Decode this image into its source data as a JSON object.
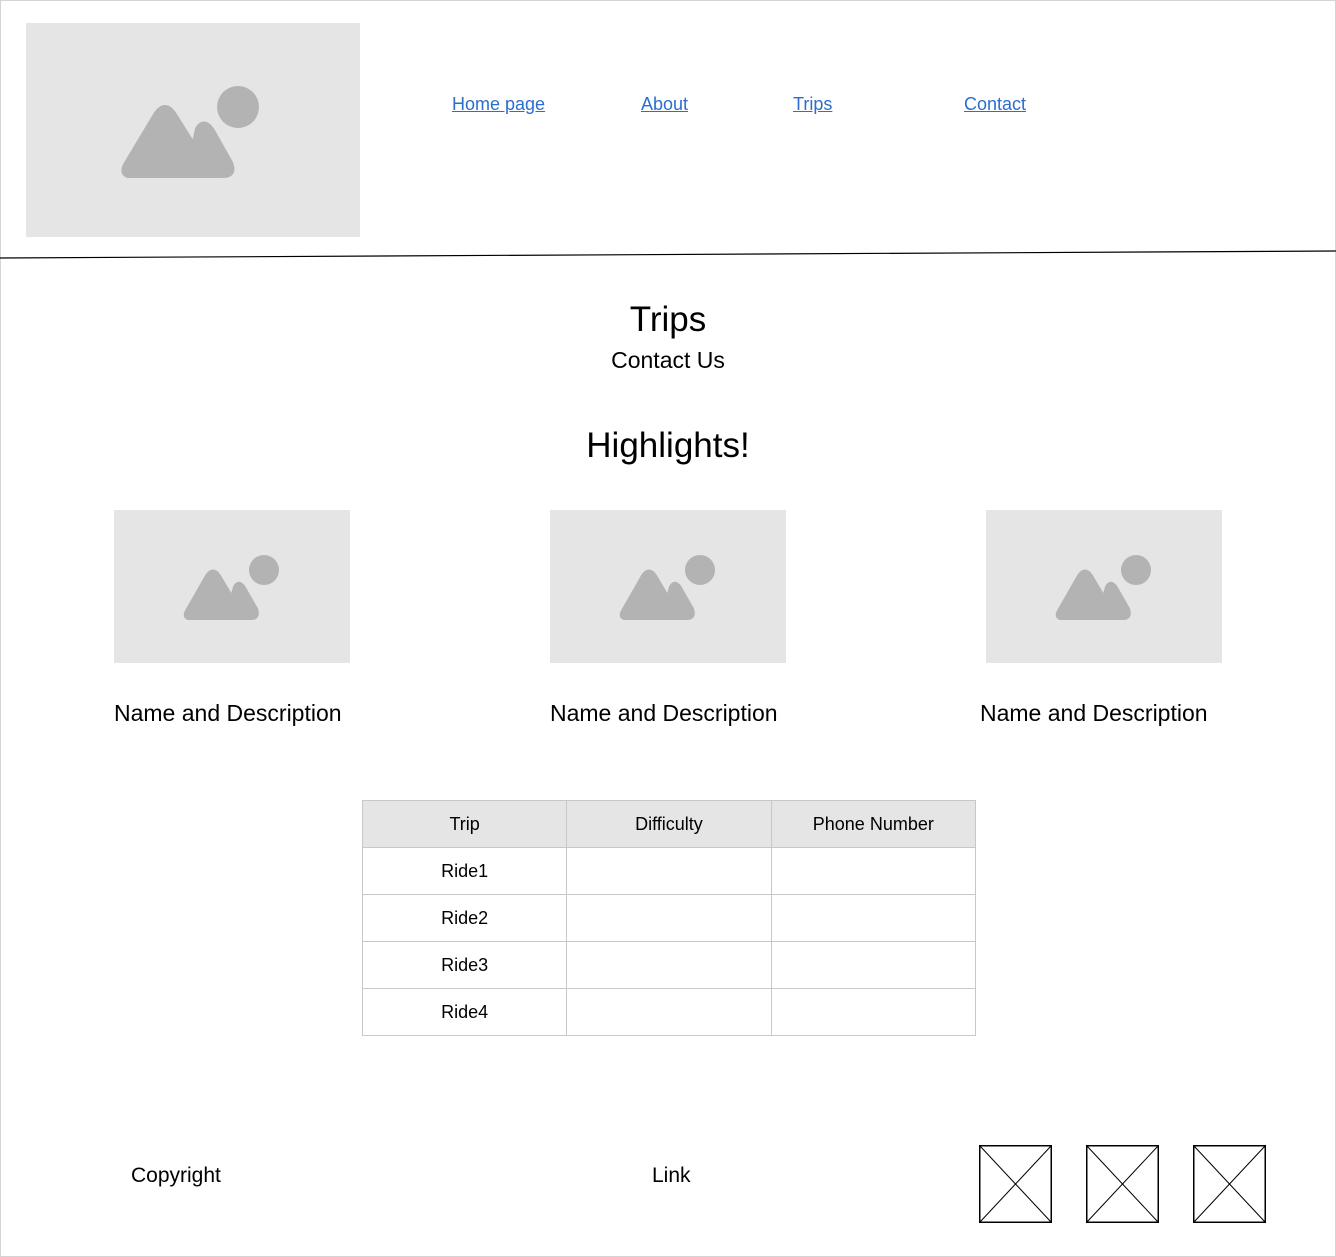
{
  "header": {
    "logo_icon": "image-placeholder-icon",
    "nav": [
      {
        "label": "Home page"
      },
      {
        "label": "About"
      },
      {
        "label": "Trips"
      },
      {
        "label": "Contact"
      }
    ],
    "link_color": "#2a6ecf"
  },
  "main": {
    "title": "Trips",
    "subtitle": "Contact Us",
    "highlights_heading": "Highlights!",
    "cards": [
      {
        "image_icon": "image-placeholder-icon",
        "caption": "Name and Description"
      },
      {
        "image_icon": "image-placeholder-icon",
        "caption": "Name and Description"
      },
      {
        "image_icon": "image-placeholder-icon",
        "caption": "Name and Description"
      }
    ]
  },
  "table": {
    "headers": [
      "Trip",
      "Difficulty",
      "Phone Number"
    ],
    "rows": [
      [
        "Ride1",
        "",
        ""
      ],
      [
        "Ride2",
        "",
        ""
      ],
      [
        "Ride3",
        "",
        ""
      ],
      [
        "Ride4",
        "",
        ""
      ]
    ]
  },
  "footer": {
    "copyright": "Copyright",
    "link": "Link",
    "social_icons": [
      "social-icon-placeholder",
      "social-icon-placeholder",
      "social-icon-placeholder"
    ]
  },
  "colors": {
    "placeholder_bg": "#e5e5e5",
    "placeholder_glyph": "#b3b3b3",
    "table_header_bg": "#e5e5e5"
  }
}
